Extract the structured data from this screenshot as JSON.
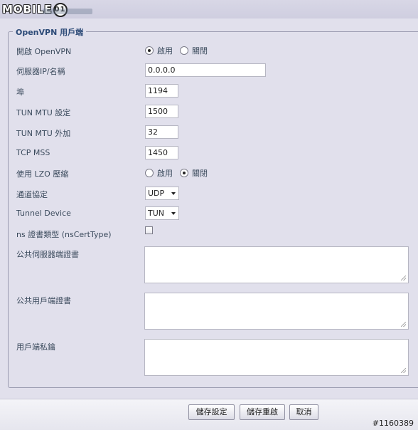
{
  "watermark": {
    "logo": "MOBILE",
    "badge": "01",
    "post_id": "#1160389"
  },
  "section": {
    "legend": "OpenVPN 用戶端"
  },
  "fields": {
    "enable": {
      "label": "開啟 OpenVPN",
      "options": [
        "啟用",
        "關閉"
      ],
      "selected": "啟用"
    },
    "server": {
      "label": "伺服器IP/名稱",
      "value": "0.0.0.0"
    },
    "port": {
      "label": "埠",
      "value": "1194"
    },
    "tun_mtu": {
      "label": "TUN MTU 設定",
      "value": "1500"
    },
    "tun_mtu_extra": {
      "label": "TUN MTU 外加",
      "value": "32"
    },
    "tcp_mss": {
      "label": "TCP MSS",
      "value": "1450"
    },
    "lzo": {
      "label": "使用 LZO 壓縮",
      "options": [
        "啟用",
        "關閉"
      ],
      "selected": "關閉"
    },
    "protocol": {
      "label": "通道協定",
      "value": "UDP"
    },
    "tunnel_device": {
      "label": "Tunnel Device",
      "value": "TUN"
    },
    "ns_cert_type": {
      "label": "ns 證書類型 (nsCertType)",
      "checked": false
    },
    "server_cert": {
      "label": "公共伺服器端證書",
      "value": ""
    },
    "client_cert": {
      "label": "公共用戶端證書",
      "value": ""
    },
    "client_key": {
      "label": "用戶端私鑰",
      "value": ""
    }
  },
  "buttons": {
    "save_settings": "儲存設定",
    "save_reboot": "儲存重啟",
    "cancel": "取消"
  }
}
